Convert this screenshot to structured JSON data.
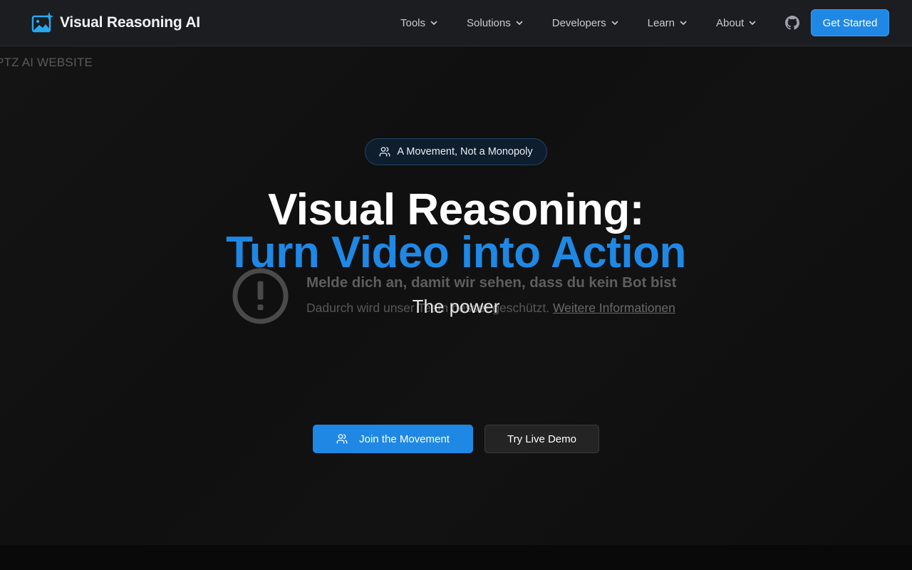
{
  "header": {
    "brand": "Visual Reasoning AI",
    "nav": [
      {
        "label": "Tools"
      },
      {
        "label": "Solutions"
      },
      {
        "label": "Developers"
      },
      {
        "label": "Learn"
      },
      {
        "label": "About"
      }
    ],
    "cta_label": "Get Started"
  },
  "hero": {
    "site_label": "PTZ AI WEBSITE",
    "badge": "A Movement, Not a Monopoly",
    "title_line1": "Visual Reasoning:",
    "title_line2": "Turn Video into Action",
    "tagline": "The power",
    "bot_notice": {
      "title": "Melde dich an, damit wir sehen, dass du kein Bot bist",
      "text": "Dadurch wird unser Team besser geschützt. ",
      "link": "Weitere Informationen"
    },
    "primary_button": "Join the Movement",
    "secondary_button": "Try Live Demo"
  },
  "colors": {
    "accent": "#1f88e5",
    "background": "#0a0a0a",
    "navbar": "#1b1d21"
  },
  "icons": {
    "logo": "image-sparkle-icon",
    "chevron": "chevron-down-icon",
    "github": "github-icon",
    "users": "users-icon",
    "alert": "alert-circle-icon"
  }
}
